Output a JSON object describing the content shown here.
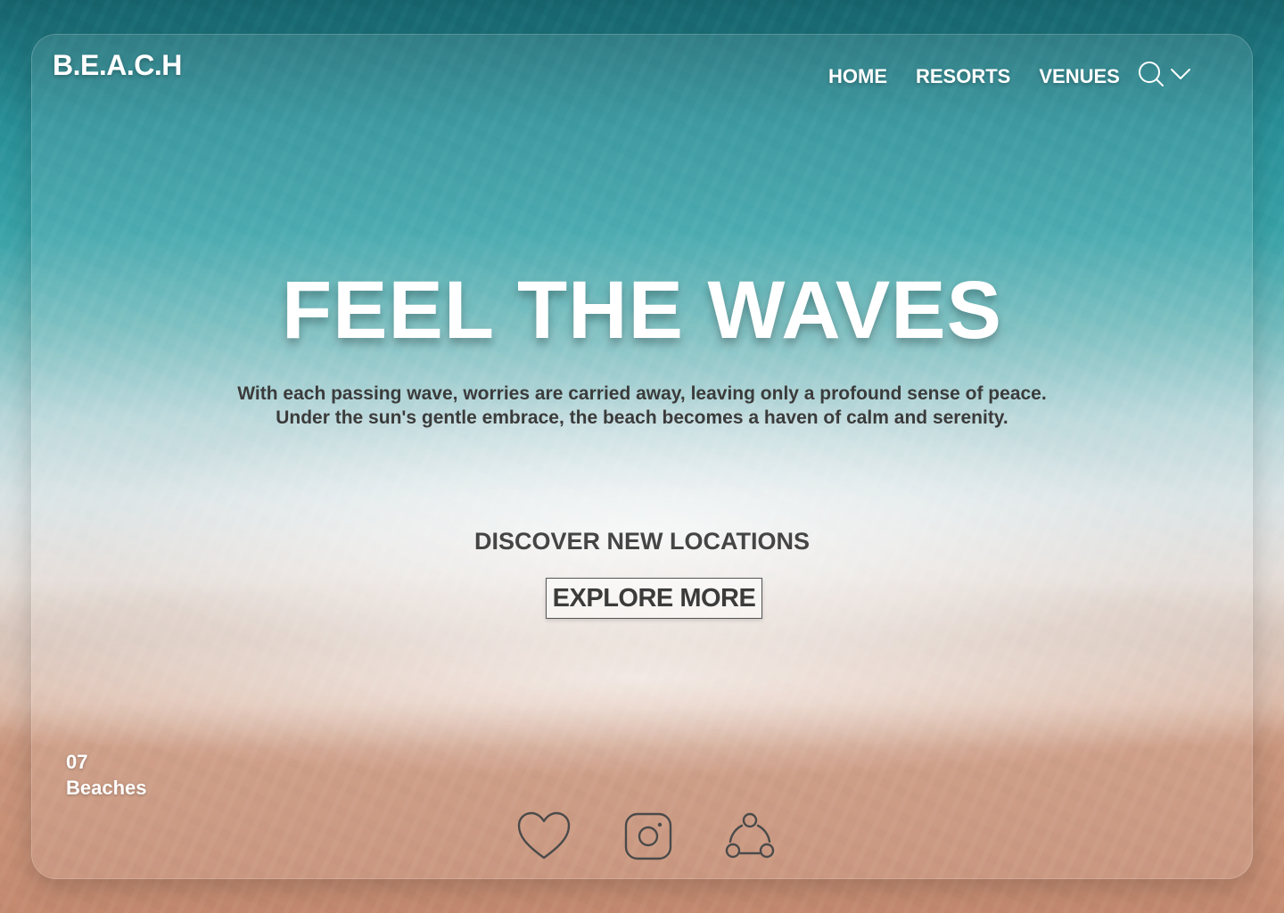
{
  "brand": {
    "logo": "B.E.A.C.H"
  },
  "nav": {
    "items": [
      {
        "label": "HOME"
      },
      {
        "label": "RESORTS"
      },
      {
        "label": "VENUES"
      }
    ],
    "icons": [
      "search-icon",
      "chevron-down-icon"
    ]
  },
  "hero": {
    "title": "FEEL THE WAVES",
    "line1": "With each passing wave, worries are carried away, leaving only a profound sense of peace.",
    "line2": "Under the sun's gentle embrace, the beach becomes a haven of calm and serenity."
  },
  "cta": {
    "heading": "DISCOVER NEW LOCATIONS",
    "button": "EXPLORE MORE"
  },
  "stats": {
    "count": "07",
    "label": "Beaches"
  },
  "social": {
    "icons": [
      "heart-icon",
      "instagram-icon",
      "share-icon"
    ]
  },
  "colors": {
    "text_dark": "#3b3b3b",
    "text_light": "#ffffff",
    "icon_stroke": "#4a4a4a"
  }
}
